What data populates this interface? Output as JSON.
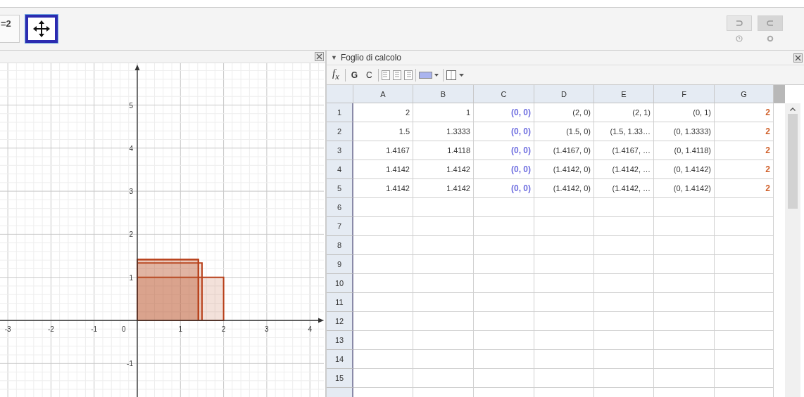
{
  "toolbar": {
    "tools": [
      {
        "kind": "slider",
        "label": "=2",
        "selected": false
      },
      {
        "kind": "move",
        "selected": true
      }
    ]
  },
  "graphics": {
    "x_ticks": [
      "-3",
      "-2",
      "-1",
      "1",
      "2",
      "3",
      "4"
    ],
    "y_ticks": [
      "5",
      "4",
      "3",
      "2",
      "1",
      "-1"
    ],
    "origin_label": "0"
  },
  "spreadsheet": {
    "title": "Foglio di calcolo",
    "title_arrow": "▼",
    "tools": [
      {
        "kind": "fx",
        "label": "f$_{x}$"
      },
      {
        "kind": "bold",
        "label": "G"
      },
      {
        "kind": "italic",
        "label": "C"
      }
    ],
    "columns": [
      {
        "label": "A"
      },
      {
        "label": "B"
      },
      {
        "label": "C",
        "color": "#6f6fe0"
      },
      {
        "label": "D"
      },
      {
        "label": "E"
      },
      {
        "label": "F"
      },
      {
        "label": "G",
        "color": "#d0602a"
      }
    ],
    "rows": [
      {
        "label": "1",
        "cells": [
          "2",
          "1",
          "(0, 0)",
          "(2, 0)",
          "(2, 1)",
          "(0, 1)",
          "2"
        ]
      },
      {
        "label": "2",
        "cells": [
          "1.5",
          "1.3333",
          "(0, 0)",
          "(1.5, 0)",
          "(1.5, 1.33…",
          "(0, 1.3333)",
          "2"
        ]
      },
      {
        "label": "3",
        "cells": [
          "1.4167",
          "1.4118",
          "(0, 0)",
          "(1.4167, 0)",
          "(1.4167, …",
          "(0, 1.4118)",
          "2"
        ]
      },
      {
        "label": "4",
        "cells": [
          "1.4142",
          "1.4142",
          "(0, 0)",
          "(1.4142, 0)",
          "(1.4142, …",
          "(0, 1.4142)",
          "2"
        ]
      },
      {
        "label": "5",
        "cells": [
          "1.4142",
          "1.4142",
          "(0, 0)",
          "(1.4142, 0)",
          "(1.4142, …",
          "(0, 1.4142)",
          "2"
        ]
      },
      {
        "label": "6"
      },
      {
        "label": "7"
      },
      {
        "label": "8"
      },
      {
        "label": "9"
      },
      {
        "label": "10"
      },
      {
        "label": "11"
      },
      {
        "label": "12"
      },
      {
        "label": "13"
      },
      {
        "label": "14"
      },
      {
        "label": "15"
      }
    ]
  }
}
